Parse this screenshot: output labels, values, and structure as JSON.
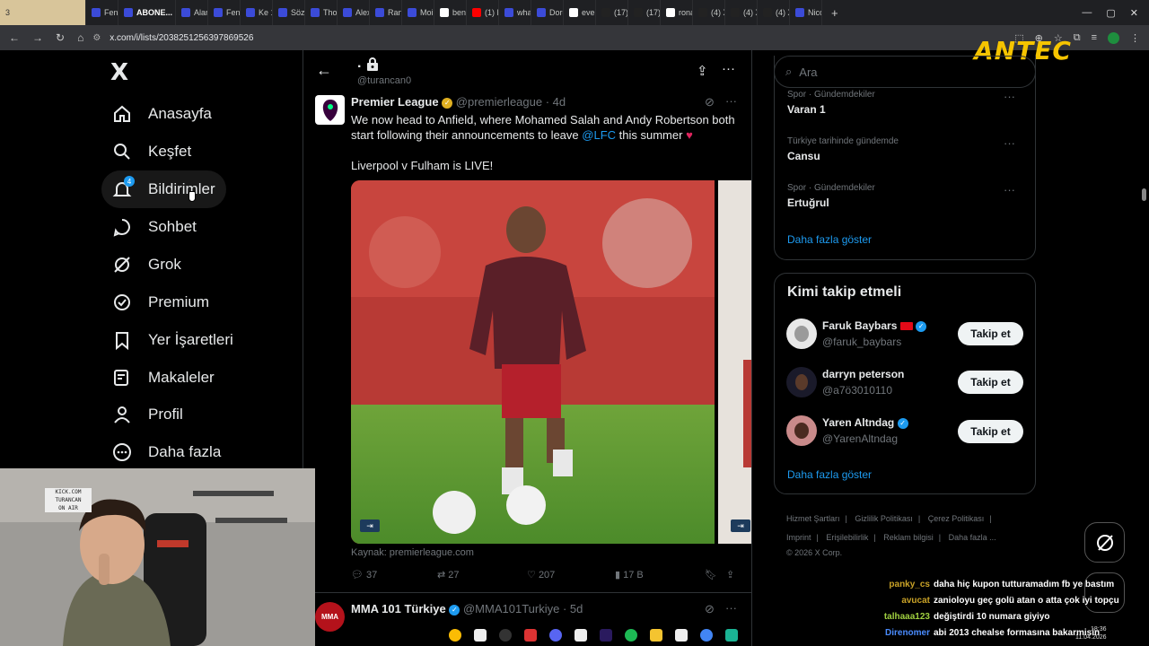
{
  "browser": {
    "tabs": [
      {
        "label": "3",
        "color": "#d8c59a"
      },
      {
        "label": "Fenerb",
        "color": "#3b4bd8"
      },
      {
        "label": "ABONE...",
        "color": "#3b4bd8"
      },
      {
        "label": "Alan",
        "color": "#3b4bd8"
      },
      {
        "label": "Fene",
        "color": "#3b4bd8"
      },
      {
        "label": "Ke 10",
        "color": "#3b4bd8"
      },
      {
        "label": "Sözl",
        "color": "#3b4bd8"
      },
      {
        "label": "Tho",
        "color": "#3b4bd8"
      },
      {
        "label": "Alex",
        "color": "#3b4bd8"
      },
      {
        "label": "Ranc",
        "color": "#3b4bd8"
      },
      {
        "label": "Moi",
        "color": "#3b4bd8"
      },
      {
        "label": "benl",
        "color": "#ffffff"
      },
      {
        "label": "(1) H",
        "color": "#ff0000"
      },
      {
        "label": "what",
        "color": "#3b4bd8"
      },
      {
        "label": "Dorg",
        "color": "#3b4bd8"
      },
      {
        "label": "ever",
        "color": "#ffffff"
      },
      {
        "label": "(17)",
        "color": "#222222"
      },
      {
        "label": "(17)",
        "color": "#222222"
      },
      {
        "label": "rona",
        "color": "#ffffff"
      },
      {
        "label": "(4) X",
        "color": "#222222"
      },
      {
        "label": "(4) X",
        "color": "#222222"
      },
      {
        "label": "(4) X",
        "color": "#222222"
      },
      {
        "label": "Nico",
        "color": "#3b4bd8"
      }
    ],
    "new_tab": "+",
    "url": "x.com/i/lists/2038251256397869526",
    "brand_overlay": "ANTEC"
  },
  "nav": {
    "logo": "X",
    "items": [
      {
        "label": "Anasayfa",
        "icon": "home-icon"
      },
      {
        "label": "Keşfet",
        "icon": "search-icon"
      },
      {
        "label": "Bildirimler",
        "icon": "bell-icon",
        "badge": "4"
      },
      {
        "label": "Sohbet",
        "icon": "chat-icon"
      },
      {
        "label": "Grok",
        "icon": "grok-icon"
      },
      {
        "label": "Premium",
        "icon": "premium-icon"
      },
      {
        "label": "Yer İşaretleri",
        "icon": "bookmark-icon"
      },
      {
        "label": "Makaleler",
        "icon": "article-icon"
      },
      {
        "label": "Profil",
        "icon": "profile-icon"
      },
      {
        "label": "Daha fazla",
        "icon": "more-icon"
      }
    ]
  },
  "list_header": {
    "title": ".",
    "handle": "@turancan0"
  },
  "tweet1": {
    "name": "Premier League",
    "handle": "@premierleague",
    "time": "· 4d",
    "text_line1": "We now head to Anfield, where Mohamed Salah and Andy Robertson both",
    "text_line2a": "start following their announcements to leave ",
    "mention": "@LFC",
    "text_line2b": " this summer",
    "text_line3": "Liverpool v Fulham is LIVE!",
    "source": "Kaynak: premierleague.com",
    "replies": "37",
    "retweets": "27",
    "likes": "207",
    "views": "17 B"
  },
  "tweet2": {
    "name": "MMA 101 Türkiye",
    "handle": "@MMA101Turkiye",
    "time": "· 5d"
  },
  "search": {
    "placeholder": "Ara"
  },
  "trends": {
    "items": [
      {
        "meta": "Spor · Gündemdekiler",
        "name": "Varan 1"
      },
      {
        "meta": "Türkiye tarihinde gündemde",
        "name": "Cansu"
      },
      {
        "meta": "Spor · Gündemdekiler",
        "name": "Ertuğrul"
      }
    ],
    "more": "Daha fazla göster"
  },
  "who_to_follow": {
    "title": "Kimi takip etmeli",
    "users": [
      {
        "name": "Faruk Baybars",
        "handle": "@faruk_baybars",
        "button": "Takip et"
      },
      {
        "name": "darryn peterson",
        "handle": "@a7ö3010110",
        "button": "Takip et"
      },
      {
        "name": "Yaren Altndag",
        "handle": "@YarenAltndag",
        "button": "Takip et"
      }
    ],
    "more": "Daha fazla göster"
  },
  "footer": {
    "links": [
      "Hizmet Şartları",
      "Gizlilik Politikası",
      "Çerez Politikası",
      "Imprint",
      "Erişilebilirlik",
      "Reklam bilgisi",
      "Daha fazla ..."
    ],
    "copyright": "© 2026 X Corp."
  },
  "chat": [
    {
      "user": "panky_cs",
      "msg": "daha hiç kupon tutturamadım fb ye bastım",
      "color": "#c9a227"
    },
    {
      "user": "avucat",
      "msg": "zanioloyu geç golü atan o atta çok iyi topçu",
      "color": "#c9a227"
    },
    {
      "user": "talhaaa123",
      "msg": "değiştirdi 10 numara giyiyo",
      "color": "#a0d040"
    },
    {
      "user": "Direnomer",
      "msg": "abi 2013 chealse formasına bakarmisin",
      "color": "#4a8cff"
    }
  ],
  "clock": {
    "time": "18:36",
    "date": "11.04.2026"
  },
  "cam_sign": [
    "KICK.COM",
    "TURANCAN",
    "ON AIR"
  ]
}
